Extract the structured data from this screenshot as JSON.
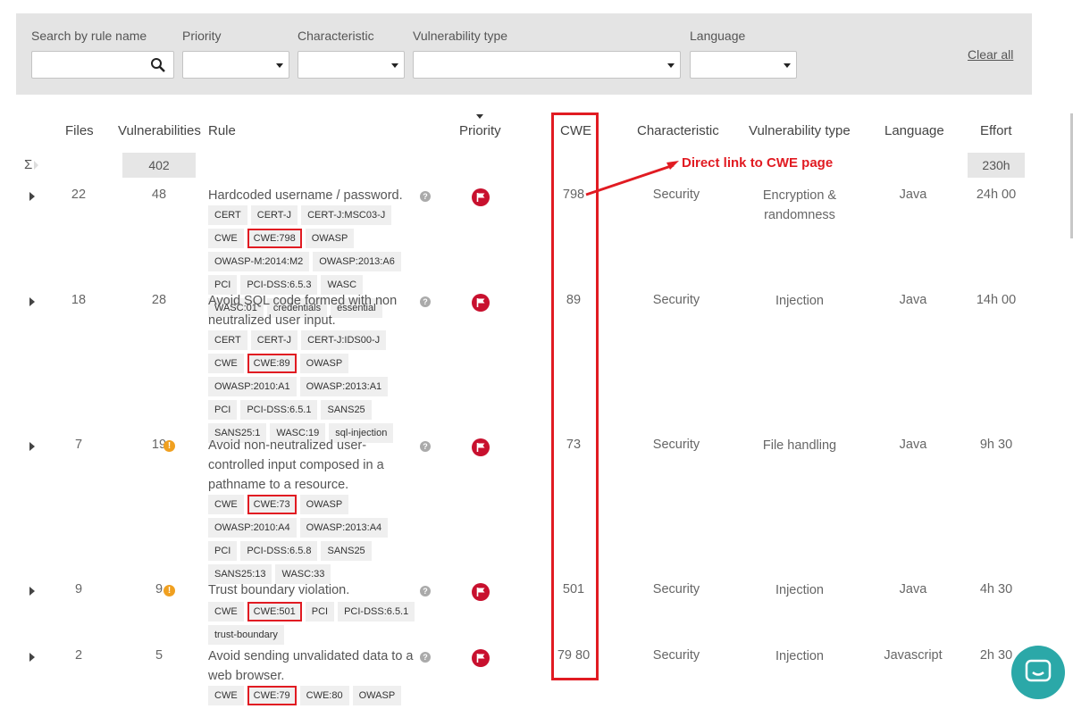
{
  "filters": {
    "search_label": "Search by rule name",
    "search_value": "",
    "priority_label": "Priority",
    "characteristic_label": "Characteristic",
    "vuln_type_label": "Vulnerability type",
    "language_label": "Language",
    "clear_all": "Clear all"
  },
  "columns": {
    "files": "Files",
    "vulnerabilities": "Vulnerabilities",
    "rule": "Rule",
    "priority": "Priority",
    "cwe": "CWE",
    "characteristic": "Characteristic",
    "vuln_type": "Vulnerability type",
    "language": "Language",
    "effort": "Effort"
  },
  "totals": {
    "sigma": "Σ",
    "vulnerabilities": "402",
    "effort": "230h"
  },
  "annotation": "Direct link to CWE page",
  "rows": [
    {
      "files": "22",
      "vulns": "48",
      "warning": false,
      "rule": "Hardcoded username / password.",
      "tags": [
        "CERT",
        "CERT-J",
        "CERT-J:MSC03-J",
        "CWE",
        "CWE:798",
        "OWASP",
        "OWASP-M:2014:M2",
        "OWASP:2013:A6",
        "PCI",
        "PCI-DSS:6.5.3",
        "WASC",
        "WASC:01",
        "credentials",
        "essential"
      ],
      "highlight": "CWE:798",
      "cwe": "798",
      "characteristic": "Security",
      "vuln_type": "Encryption & randomness",
      "language": "Java",
      "effort": "24h 00"
    },
    {
      "files": "18",
      "vulns": "28",
      "warning": false,
      "rule": "Avoid SQL code formed with non neutralized user input.",
      "tags": [
        "CERT",
        "CERT-J",
        "CERT-J:IDS00-J",
        "CWE",
        "CWE:89",
        "OWASP",
        "OWASP:2010:A1",
        "OWASP:2013:A1",
        "PCI",
        "PCI-DSS:6.5.1",
        "SANS25",
        "SANS25:1",
        "WASC:19",
        "sql-injection"
      ],
      "highlight": "CWE:89",
      "cwe": "89",
      "characteristic": "Security",
      "vuln_type": "Injection",
      "language": "Java",
      "effort": "14h 00"
    },
    {
      "files": "7",
      "vulns": "19",
      "warning": true,
      "rule": "Avoid non-neutralized user-controlled input composed in a pathname to a resource.",
      "tags": [
        "CWE",
        "CWE:73",
        "OWASP",
        "OWASP:2010:A4",
        "OWASP:2013:A4",
        "PCI",
        "PCI-DSS:6.5.8",
        "SANS25",
        "SANS25:13",
        "WASC:33"
      ],
      "highlight": "CWE:73",
      "cwe": "73",
      "characteristic": "Security",
      "vuln_type": "File handling",
      "language": "Java",
      "effort": "9h 30"
    },
    {
      "files": "9",
      "vulns": "9",
      "warning": true,
      "rule": "Trust boundary violation.",
      "tags": [
        "CWE",
        "CWE:501",
        "PCI",
        "PCI-DSS:6.5.1",
        "trust-boundary"
      ],
      "highlight": "CWE:501",
      "cwe": "501",
      "characteristic": "Security",
      "vuln_type": "Injection",
      "language": "Java",
      "effort": "4h 30"
    },
    {
      "files": "2",
      "vulns": "5",
      "warning": false,
      "rule": "Avoid sending unvalidated data to a web browser.",
      "tags": [
        "CWE",
        "CWE:79",
        "CWE:80",
        "OWASP"
      ],
      "highlight": "CWE:79",
      "cwe": "79 80",
      "characteristic": "Security",
      "vuln_type": "Injection",
      "language": "Javascript",
      "effort": "2h 30"
    }
  ],
  "colors": {
    "highlight": "#e11b22",
    "priority": "#c8102e",
    "warning": "#f0a020",
    "chat": "#2ba8a8"
  }
}
